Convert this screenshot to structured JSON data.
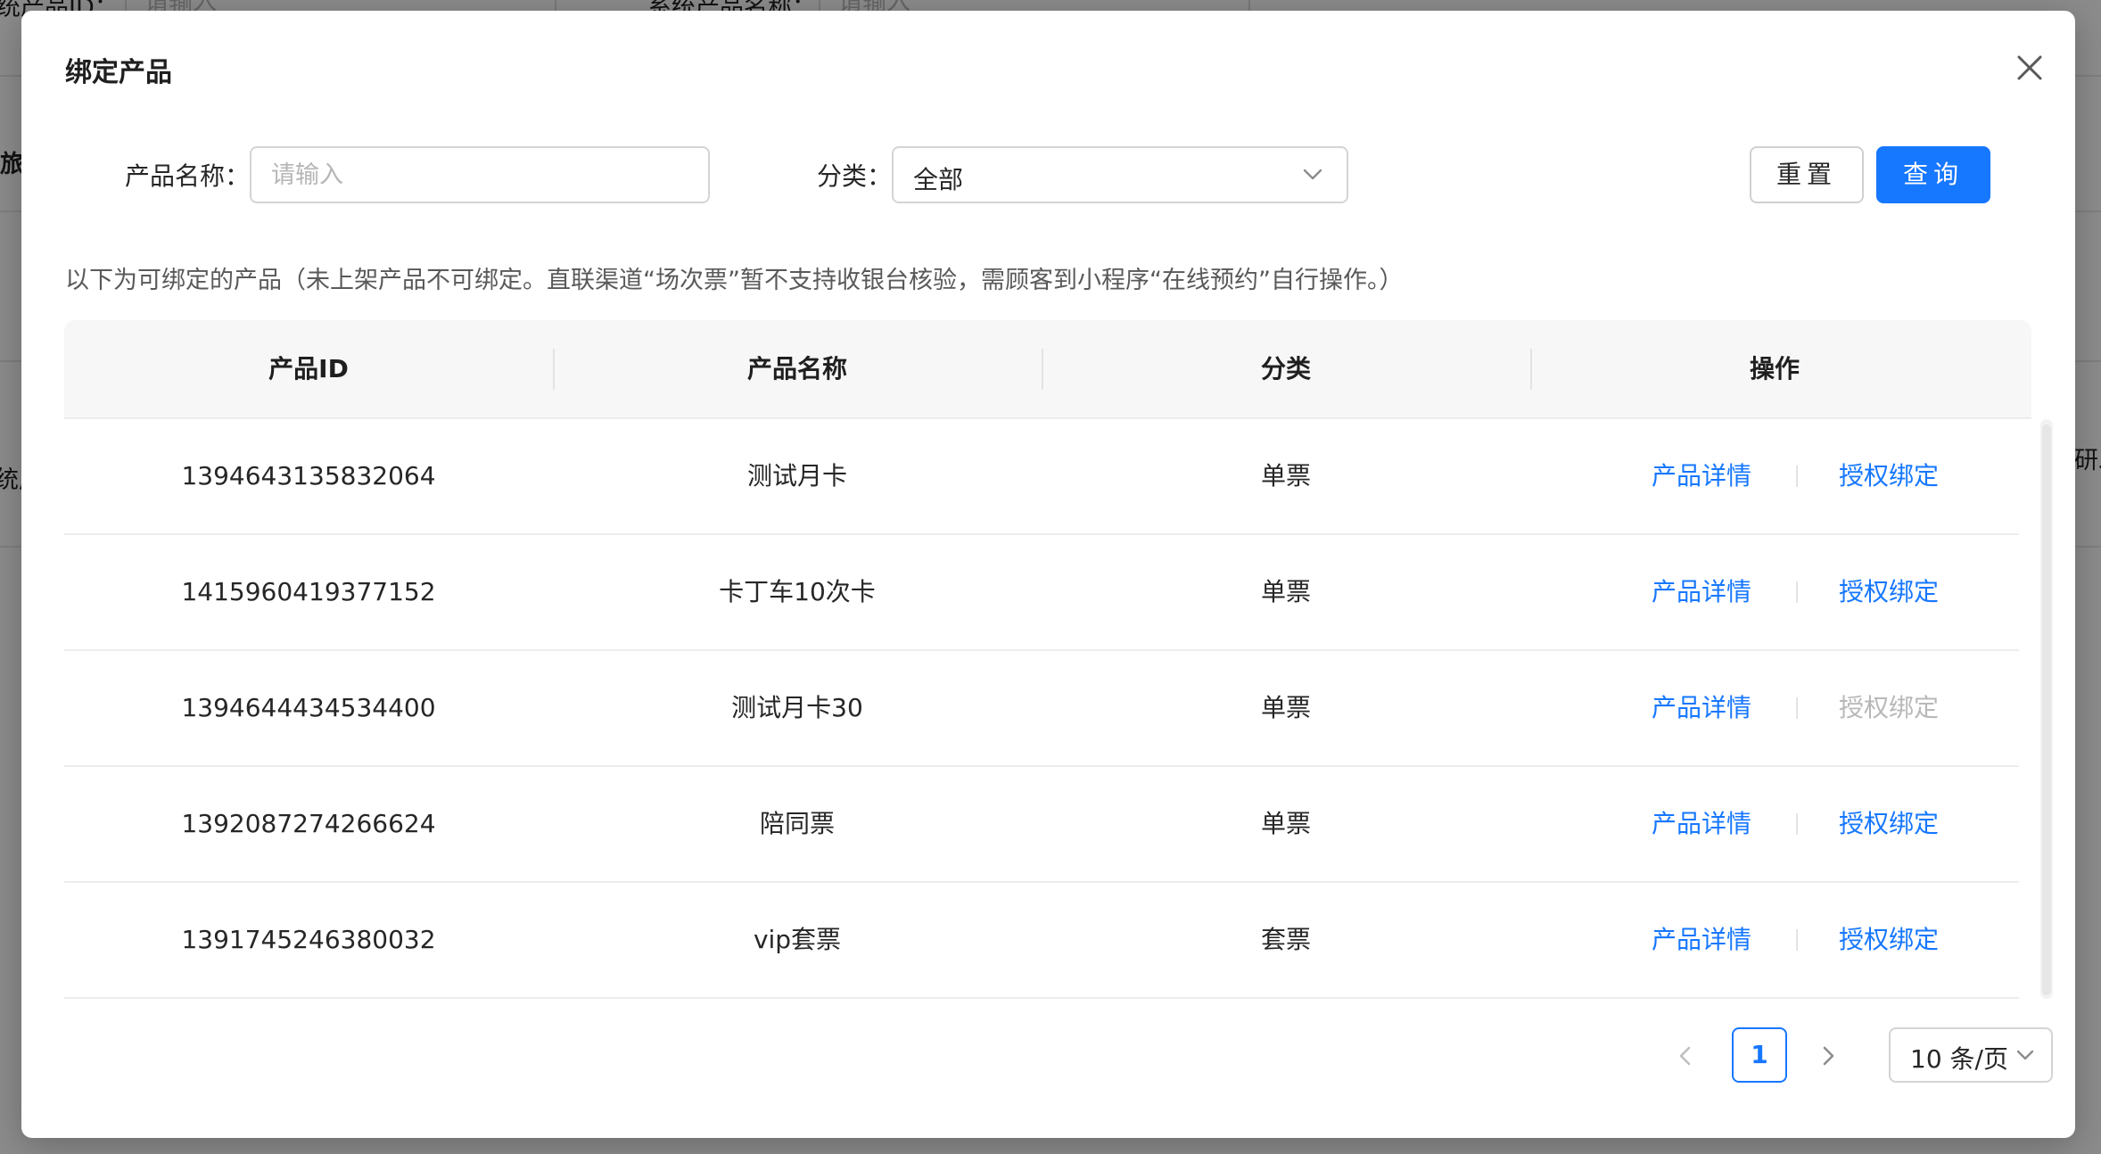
{
  "background": {
    "filter_label_1": "统产品ID：",
    "filter_placeholder_1": "请输入",
    "filter_label_2": "系统产品名称：",
    "filter_placeholder_2": "请输入",
    "side_text_1": "旅",
    "side_text_2": "统产",
    "side_text_3": "研发"
  },
  "modal": {
    "title": "绑定产品",
    "close_label": "close",
    "filters": {
      "name_label": "产品名称：",
      "name_value": "",
      "name_placeholder": "请输入",
      "category_label": "分类：",
      "category_value": "全部"
    },
    "buttons": {
      "reset": "重置",
      "query": "查询"
    },
    "hint": "以下为可绑定的产品（未上架产品不可绑定。直联渠道“场次票”暂不支持收银台核验，需顾客到小程序“在线预约”自行操作。）",
    "table": {
      "columns": [
        "产品ID",
        "产品名称",
        "分类",
        "操作"
      ],
      "rows": [
        {
          "id": "1394643135832064",
          "name": "测试月卡",
          "category": "单票",
          "detail": "产品详情",
          "bind": "授权绑定",
          "bind_enabled": true
        },
        {
          "id": "1415960419377152",
          "name": "卡丁车10次卡",
          "category": "单票",
          "detail": "产品详情",
          "bind": "授权绑定",
          "bind_enabled": true
        },
        {
          "id": "1394644434534400",
          "name": "测试月卡30",
          "category": "单票",
          "detail": "产品详情",
          "bind": "授权绑定",
          "bind_enabled": false
        },
        {
          "id": "1392087274266624",
          "name": "陪同票",
          "category": "单票",
          "detail": "产品详情",
          "bind": "授权绑定",
          "bind_enabled": true
        },
        {
          "id": "1391745246380032",
          "name": "vip套票",
          "category": "套票",
          "detail": "产品详情",
          "bind": "授权绑定",
          "bind_enabled": true
        }
      ]
    },
    "pagination": {
      "current_page": "1",
      "page_size": "10 条/页"
    }
  },
  "colors": {
    "primary": "#1677ff",
    "disabled_link": "#b8b8b8"
  }
}
